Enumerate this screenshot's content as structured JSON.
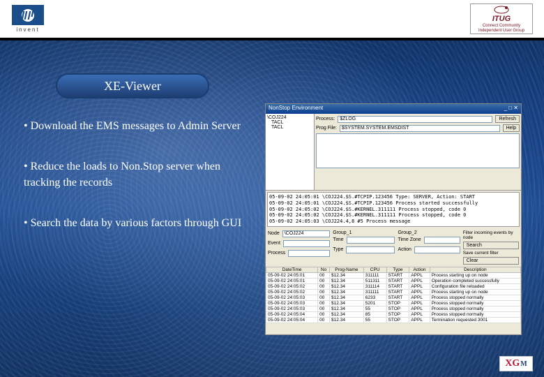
{
  "header": {
    "hp_invent": "invent",
    "itug_main": "ITUG",
    "itug_sub1": "Connect Community",
    "itug_sub2": "Independent User Group"
  },
  "title": "XE-Viewer",
  "bullets": [
    "Download the EMS messages to Admin Server",
    "Reduce the loads to Non.Stop server when tracking the records",
    "Search the data by various factors through GUI"
  ],
  "win": {
    "title": "NonStop Environment",
    "tree_root": "\\COJ224",
    "tree_items": [
      "TACL",
      "TACL"
    ],
    "field_labels": [
      "Process:",
      "Prog File:"
    ],
    "field1_value": "$ZLOG",
    "field2_value": "$SYSTEM.SYSTEM.EMSDIST",
    "refresh": "Refresh",
    "help": "Help"
  },
  "log_lines": [
    "05-09-02 24:05:01   \\COJ224.$S.#TCPIP.123456   Type: SERVER, Action: START",
    "05-09-02 24:05:01   \\COJ224.$S.#TCPIP.123456   Process started successfully",
    "05-09-02 24:05:02   \\COJ224.$S.#KERNEL.311111  Process stopped, code 0",
    "05-09-02 24:05:02   \\COJ224.$S.#KERNEL.311111  Process stopped, code 0",
    "05-09-02 24:05:03   \\COJ224.4,8  #5 Process message"
  ],
  "filter": {
    "node_label": "Node",
    "node_value": "\\COJ224",
    "event_label": "Event",
    "group1": "Group_1",
    "group2": "Group_2",
    "time_label": "Time",
    "process_label": "Process",
    "tz_label": "Time Zone",
    "info": "Filter incoming events by node",
    "info2": "Save current filter",
    "type_label": "Type",
    "action_label": "Action",
    "search": "Search",
    "clear": "Clear"
  },
  "table": {
    "columns": [
      "DateTime",
      "No",
      "Prog-Name",
      "CPU",
      "Type",
      "Action",
      "Description"
    ],
    "rows": [
      [
        "05-09-02 24:05:01",
        "00",
        "$12.34",
        "311111",
        "START",
        "APPL",
        "Process starting up on node"
      ],
      [
        "05-09-02 24:05:01",
        "00",
        "$12.34",
        "511311",
        "START",
        "APPL",
        "Operation completed successfully"
      ],
      [
        "05-09-02 24:05:02",
        "00",
        "$12.34",
        "311114",
        "START",
        "APPL",
        "Configuration file reloaded"
      ],
      [
        "05-09-02 24:05:02",
        "00",
        "$12.34",
        "311111",
        "START",
        "APPL",
        "Process starting up on node"
      ],
      [
        "05-09-02 24:05:03",
        "00",
        "$12.34",
        "6233",
        "START",
        "APPL",
        "Process stopped normally"
      ],
      [
        "05-09-02 24:05:03",
        "00",
        "$12.34",
        "5201",
        "STOP",
        "APPL",
        "Process stopped normally"
      ],
      [
        "05-09-02 24:05:03",
        "00",
        "$12.34",
        "55",
        "STOP",
        "APPL",
        "Process stopped normally"
      ],
      [
        "05-09-02 24:05:04",
        "00",
        "$12.34",
        "85",
        "STOP",
        "APPL",
        "Process stopped normally"
      ],
      [
        "05-09-02 24:05:04",
        "00",
        "$12.34",
        "55",
        "STOP",
        "APPL",
        "Termination requested 3001"
      ]
    ]
  },
  "footer": {
    "x": "X",
    "g": "G",
    "m": "M"
  }
}
